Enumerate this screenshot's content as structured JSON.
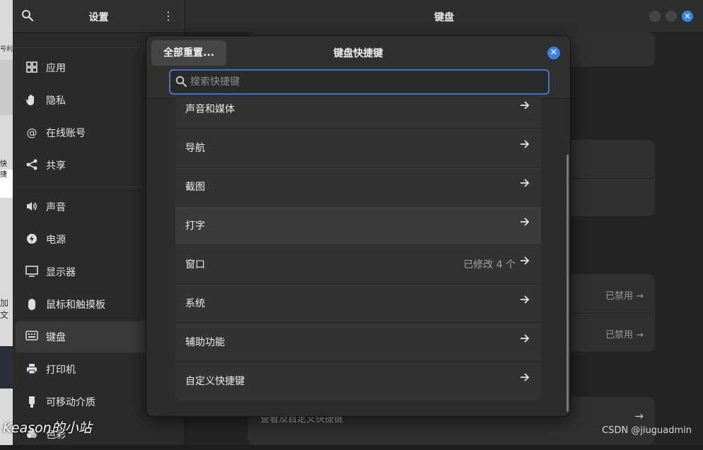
{
  "background_strip": {
    "text_top": "号利",
    "text_mid": "快捷",
    "text_low": "加文"
  },
  "sidebar": {
    "title": "设置",
    "menu_glyph": "⋮",
    "items": [
      {
        "label": "应用",
        "icon": "grid-icon"
      },
      {
        "label": "隐私",
        "icon": "hand-icon"
      },
      {
        "label": "在线账号",
        "icon": "at-icon"
      },
      {
        "label": "共享",
        "icon": "share-icon"
      },
      {
        "label": "声音",
        "icon": "speaker-icon"
      },
      {
        "label": "电源",
        "icon": "power-icon"
      },
      {
        "label": "显示器",
        "icon": "display-icon"
      },
      {
        "label": "鼠标和触摸板",
        "icon": "mouse-icon"
      },
      {
        "label": "键盘",
        "icon": "keyboard-icon",
        "active": true
      },
      {
        "label": "打印机",
        "icon": "printer-icon"
      },
      {
        "label": "可移动介质",
        "icon": "usb-icon"
      },
      {
        "label": "色彩",
        "icon": "color-icon"
      }
    ]
  },
  "main": {
    "title": "键盘",
    "disabled_1": "已禁用",
    "disabled_2": "已禁用",
    "bottom_text": "查看及自定义快捷键"
  },
  "dialog": {
    "reset_label": "全部重置...",
    "title": "键盘快捷键",
    "search_placeholder": "搜索快捷键",
    "rows": [
      {
        "label": "声音和媒体",
        "status": ""
      },
      {
        "label": "导航",
        "status": ""
      },
      {
        "label": "截图",
        "status": ""
      },
      {
        "label": "打字",
        "status": ""
      },
      {
        "label": "窗口",
        "status": "已修改 4 个"
      },
      {
        "label": "系统",
        "status": ""
      },
      {
        "label": "辅助功能",
        "status": ""
      },
      {
        "label": "自定义快捷键",
        "status": ""
      }
    ]
  },
  "watermarks": {
    "left": "Keason的小站",
    "right": "CSDN @jiuguadmin"
  },
  "colors": {
    "accent": "#3584e4",
    "focus_border": "#3f78c4"
  }
}
